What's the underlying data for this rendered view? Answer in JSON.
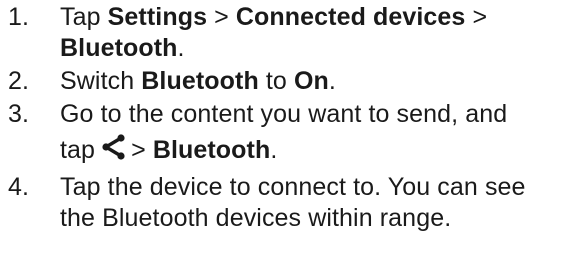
{
  "steps": [
    {
      "number": "1.",
      "t1": "Tap ",
      "b1": "Settings",
      "t2": " > ",
      "b2": "Connected devices",
      "t3": " >",
      "b3": "Bluetooth",
      "t4": "."
    },
    {
      "number": "2.",
      "t1": "Switch ",
      "b1": "Bluetooth",
      "t2": " to ",
      "b2": "On",
      "t3": "."
    },
    {
      "number": "3.",
      "t1": "Go to the content you want to send, and",
      "t2": "tap",
      "icon": "share-icon",
      "t3": "> ",
      "b1": "Bluetooth",
      "t4": "."
    },
    {
      "number": "4.",
      "t1": "Tap the device to connect to. You can see",
      "t2": "the Bluetooth devices within range."
    }
  ]
}
